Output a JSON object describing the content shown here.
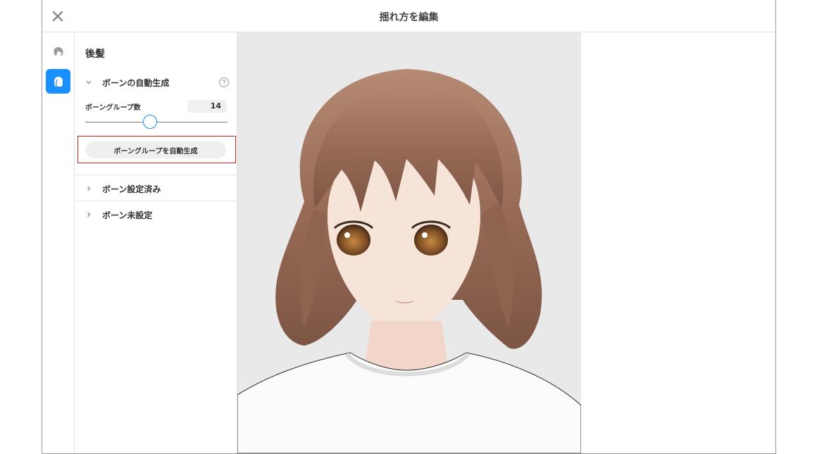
{
  "window": {
    "title": "揺れ方を編集"
  },
  "toolbar": {
    "close_icon": "close-icon"
  },
  "rail": {
    "items": [
      {
        "icon": "front-hair-icon",
        "selected": false
      },
      {
        "icon": "back-hair-icon",
        "selected": true
      }
    ],
    "accent": "#1890ff"
  },
  "panel": {
    "title": "後髪",
    "auto_section": {
      "label": "ボーンの自動生成",
      "expanded": true,
      "group_count_label": "ボーングループ数",
      "group_count_value": "14",
      "slider_fraction": 0.45,
      "generate_button_label": "ボーングループを自動生成"
    },
    "set_section": {
      "label": "ボーン設定済み",
      "expanded": false
    },
    "unset_section": {
      "label": "ボーン未設定",
      "expanded": false
    }
  },
  "viewport": {
    "content": "anime-avatar-3d-preview",
    "background": "#e9e9e9"
  },
  "colors": {
    "highlight": "#d92323",
    "accent": "#1890ff"
  }
}
